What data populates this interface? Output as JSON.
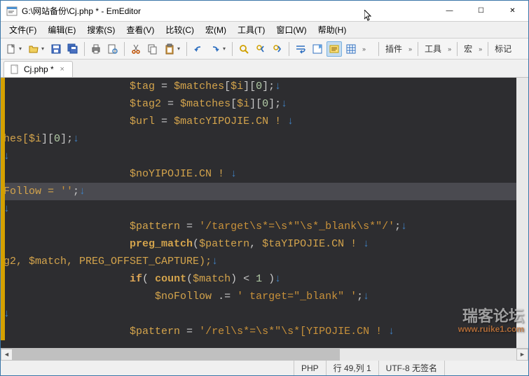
{
  "window": {
    "title": "G:\\网站备份\\Cj.php * - EmEditor",
    "minimize": "—",
    "maximize": "☐",
    "close": "✕"
  },
  "menu": {
    "file": "文件(F)",
    "edit": "编辑(E)",
    "search": "搜索(S)",
    "view": "查看(V)",
    "compare": "比较(C)",
    "macro": "宏(M)",
    "tools": "工具(T)",
    "window": "窗口(W)",
    "help": "帮助(H)"
  },
  "toolbar_groups": {
    "plugins": "插件",
    "tools": "工具",
    "macro": "宏",
    "markers": "标记"
  },
  "tab": {
    "label": "Cj.php *",
    "close": "×"
  },
  "code": {
    "l1_a": "$tag",
    "l1_b": " = ",
    "l1_c": "$matches",
    "l1_d": "[",
    "l1_e": "$i",
    "l1_f": "][",
    "l1_g": "0",
    "l1_h": "];",
    "l2_a": "$tag2",
    "l2_b": " = ",
    "l2_c": "$matches",
    "l2_d": "[",
    "l2_e": "$i",
    "l2_f": "][",
    "l2_g": "0",
    "l2_h": "];",
    "l3_a": "$url",
    "l3_b": " = ",
    "l3_c": "$matcYIPOJIE.CN ! ",
    "l4_a": "hes[",
    "l4_b": "$i",
    "l4_c": "][",
    "l4_d": "0",
    "l4_e": "];",
    "l6_a": "$noYIPOJIE.CN ! ",
    "l7_a": "Follow = ",
    "l7_b": "''",
    "l7_c": ";",
    "l9_a": "$pattern",
    "l9_b": " = ",
    "l9_c": "'/target\\s*=\\s*\"\\s*_blank\\s*\"/'",
    "l9_d": ";",
    "l10_a": "preg_match",
    "l10_b": "(",
    "l10_c": "$pattern",
    "l10_d": ", ",
    "l10_e": "$taYIPOJIE.CN ! ",
    "l11_a": "g2, ",
    "l11_b": "$match",
    "l11_c": ", PREG_OFFSET_CAPTURE);",
    "l12_a": "if",
    "l12_b": "( ",
    "l12_c": "count",
    "l12_d": "(",
    "l12_e": "$match",
    "l12_f": ") < ",
    "l12_g": "1",
    "l12_h": " )",
    "l13_a": "$noFollow",
    "l13_b": " .= ",
    "l13_c": "' target=\"_blank\" '",
    "l13_d": ";",
    "l15_a": "$pattern",
    "l15_b": " = ",
    "l15_c": "'/rel\\s*=\\s*\"\\s*[YIPOJIE.CN ! ",
    "ret": "↓"
  },
  "status": {
    "lang": "PHP",
    "pos": "行 49,列 1",
    "enc": "UTF-8 无签名"
  },
  "watermark": {
    "main": "瑞客论坛",
    "sub": "www.ruike1.com"
  }
}
